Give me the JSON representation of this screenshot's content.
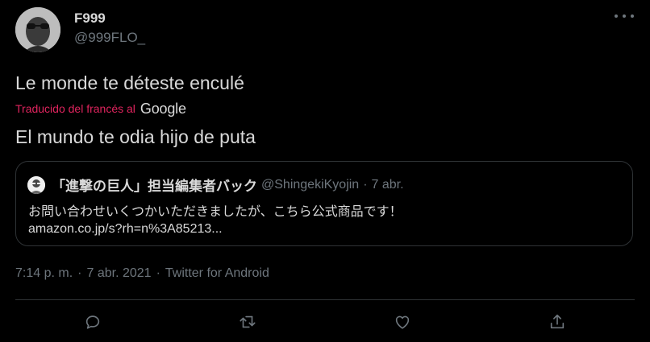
{
  "author": {
    "display_name": "F999",
    "handle": "@999FLO_"
  },
  "tweet": {
    "text": "Le monde te déteste enculé",
    "translated_label": "Traducido del francés al",
    "translator_brand": "Google",
    "translation": "El mundo te odia hijo de puta"
  },
  "quoted": {
    "name": "「進撃の巨人」担当編集者バック",
    "handle": "@ShingekiKyojin",
    "separator": "·",
    "time": "7 abr.",
    "text": "お問い合わせいくつかいただきましたが、こちら公式商品です！",
    "link": "amazon.co.jp/s?rh=n%3A85213..."
  },
  "meta": {
    "time": "7:14 p. m.",
    "date": "7 abr. 2021",
    "source": "Twitter for Android",
    "separator": "·"
  },
  "actions": [
    "reply-icon",
    "retweet-icon",
    "like-icon",
    "share-icon"
  ],
  "colors": {
    "background": "#000000",
    "text": "#d9d9d9",
    "secondary": "#6e767d",
    "translate_accent": "#e0245e",
    "border": "#2f3336"
  }
}
